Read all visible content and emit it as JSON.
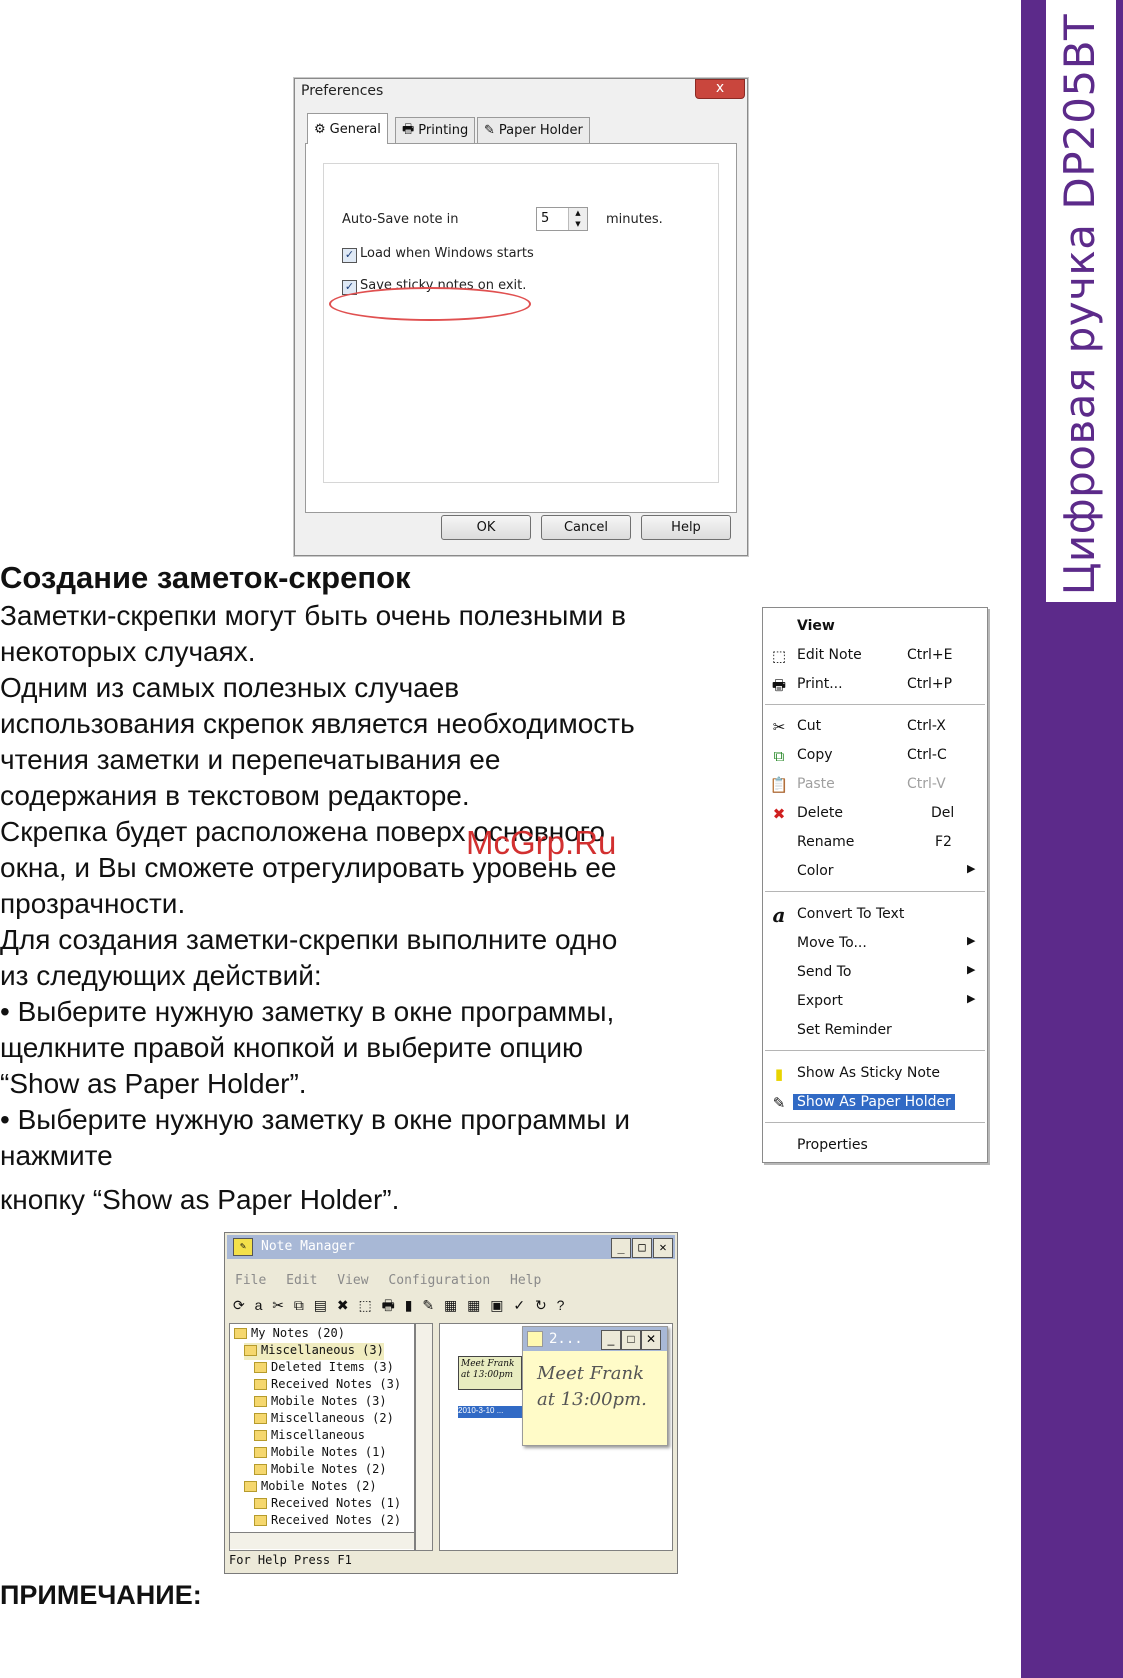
{
  "sidebar": {
    "title": "Цифровая ручка DP205BT"
  },
  "preferences": {
    "title": "Preferences",
    "close": "x",
    "tabs": [
      "General",
      "Printing",
      "Paper Holder"
    ],
    "autosave_label": "Auto-Save note in",
    "autosave_value": "5",
    "autosave_unit": "minutes.",
    "load_label": "Load when Windows starts",
    "save_label": "Save sticky notes on exit.",
    "ok": "OK",
    "cancel": "Cancel",
    "help": "Help"
  },
  "article": {
    "heading": "Создание заметок-скрепок",
    "lines": [
      "Заметки-скрепки могут быть очень полезными в",
      "некоторых случаях.",
      "Одним из самых полезных случаев",
      "использования скрепок является необходимость",
      "чтения заметки и перепечатывания ее",
      "содержания в текстовом редакторе.",
      "Скрепка будет расположена поверх основного",
      "окна, и Вы сможете отрегулировать уровень ее",
      "прозрачности.",
      "Для создания заметки-скрепки выполните одно",
      "из следующих действий:",
      "• Выберите нужную заметку в окне программы,",
      "щелкните правой кнопкой и выберите опцию",
      "“Show as Paper Holder”.",
      "• Выберите нужную заметку в окне программы и",
      "нажмите"
    ],
    "last_line": "кнопку “Show as Paper Holder”.",
    "note_heading": "ПРИМЕЧАНИЕ:"
  },
  "watermark": "McGrp.Ru",
  "context_menu": {
    "items": [
      {
        "label": "View",
        "shortcut": "",
        "icon": ""
      },
      {
        "label": "Edit Note",
        "shortcut": "Ctrl+E",
        "icon": "⬚"
      },
      {
        "label": "Print...",
        "shortcut": "Ctrl+P",
        "icon": "🖶"
      },
      {
        "label": "Cut",
        "shortcut": "Ctrl-X",
        "icon": "✂"
      },
      {
        "label": "Copy",
        "shortcut": "Ctrl-C",
        "icon": "⧉"
      },
      {
        "label": "Paste",
        "shortcut": "Ctrl-V",
        "icon": "📋"
      },
      {
        "label": "Delete",
        "shortcut": "Del",
        "icon": "✖"
      },
      {
        "label": "Rename",
        "shortcut": "F2",
        "icon": ""
      },
      {
        "label": "Color",
        "shortcut": "",
        "icon": ""
      },
      {
        "label": "Convert To Text",
        "shortcut": "",
        "icon": "a"
      },
      {
        "label": "Move To...",
        "shortcut": "",
        "icon": ""
      },
      {
        "label": "Send To",
        "shortcut": "",
        "icon": ""
      },
      {
        "label": "Export",
        "shortcut": "",
        "icon": ""
      },
      {
        "label": "Set Reminder",
        "shortcut": "",
        "icon": ""
      },
      {
        "label": "Show As Sticky Note",
        "shortcut": "",
        "icon": "▮"
      },
      {
        "label": "Show As Paper Holder",
        "shortcut": "",
        "icon": "✎"
      },
      {
        "label": "Properties",
        "shortcut": "",
        "icon": ""
      }
    ],
    "arrow": "▶"
  },
  "note_manager": {
    "title": "Note Manager",
    "menu": [
      "File",
      "Edit",
      "View",
      "Configuration",
      "Help"
    ],
    "toolbar": "⟳ a ✂ ⧉ ▤ ✖ ⬚ 🖶 ▮ ✎ ▦ ▦ ▣ ✓ ↻ ?",
    "tree": [
      "My Notes (20)",
      "Miscellaneous (3)",
      "Deleted Items (3)",
      "Received Notes (3)",
      "Mobile Notes (3)",
      "Miscellaneous (2)",
      "Miscellaneous",
      "Mobile Notes (1)",
      "Mobile Notes (2)",
      "Mobile Notes (2)",
      "Received Notes (1)",
      "Received Notes (2)"
    ],
    "thumb_text": "Meet Frank at 13:00pm",
    "thumb_date": "2010-3-10 ...",
    "sticky_title": "2...",
    "sticky_line1": "Meet  Frank",
    "sticky_line2": "at  13:00pm.",
    "status": "For Help Press F1"
  }
}
